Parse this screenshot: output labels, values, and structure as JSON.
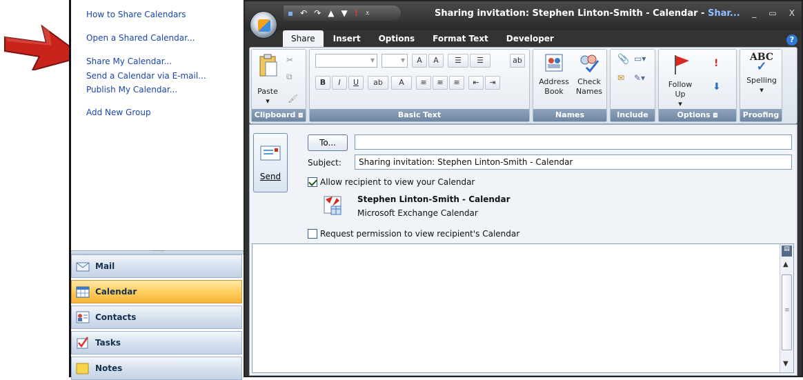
{
  "links": {
    "how_to_share": "How to Share Calendars",
    "open_shared": "Open a Shared Calendar...",
    "share_my": "Share My Calendar...",
    "send_via_email": "Send a Calendar via E-mail...",
    "publish": "Publish My Calendar...",
    "add_group": "Add New Group"
  },
  "nav": {
    "grip": "......",
    "mail": "Mail",
    "calendar": "Calendar",
    "contacts": "Contacts",
    "tasks": "Tasks",
    "notes": "Notes"
  },
  "window": {
    "title_main": "Sharing invitation: Stephen Linton-Smith - Calendar - ",
    "title_dim": "Shar...",
    "minimize": "_",
    "maximize": "▭",
    "close": "X"
  },
  "tabs": [
    "Share",
    "Insert",
    "Options",
    "Format Text",
    "Developer"
  ],
  "help": "?",
  "ribbon": {
    "clipboard": {
      "label": "Clipboard",
      "paste": "Paste"
    },
    "basic_text": {
      "label": "Basic Text",
      "bold": "B",
      "italic": "I",
      "underline": "U"
    },
    "names": {
      "label": "Names",
      "address_book": "Address Book",
      "check_names": "Check Names"
    },
    "include": {
      "label": "Include"
    },
    "options": {
      "label": "Options",
      "follow_up": "Follow Up"
    },
    "proofing": {
      "label": "Proofing",
      "spelling": "Spelling",
      "abc": "ABC"
    }
  },
  "form": {
    "send": "Send",
    "to_button": "To...",
    "to_value": "",
    "subject_label": "Subject:",
    "subject_value": "Sharing invitation: Stephen Linton-Smith - Calendar",
    "allow_label": "Allow recipient to view your Calendar",
    "calendar_name": "Stephen Linton-Smith - Calendar",
    "calendar_type": "Microsoft Exchange Calendar",
    "request_label": "Request permission to view recipient's Calendar",
    "allow_checked": true,
    "request_checked": false
  }
}
